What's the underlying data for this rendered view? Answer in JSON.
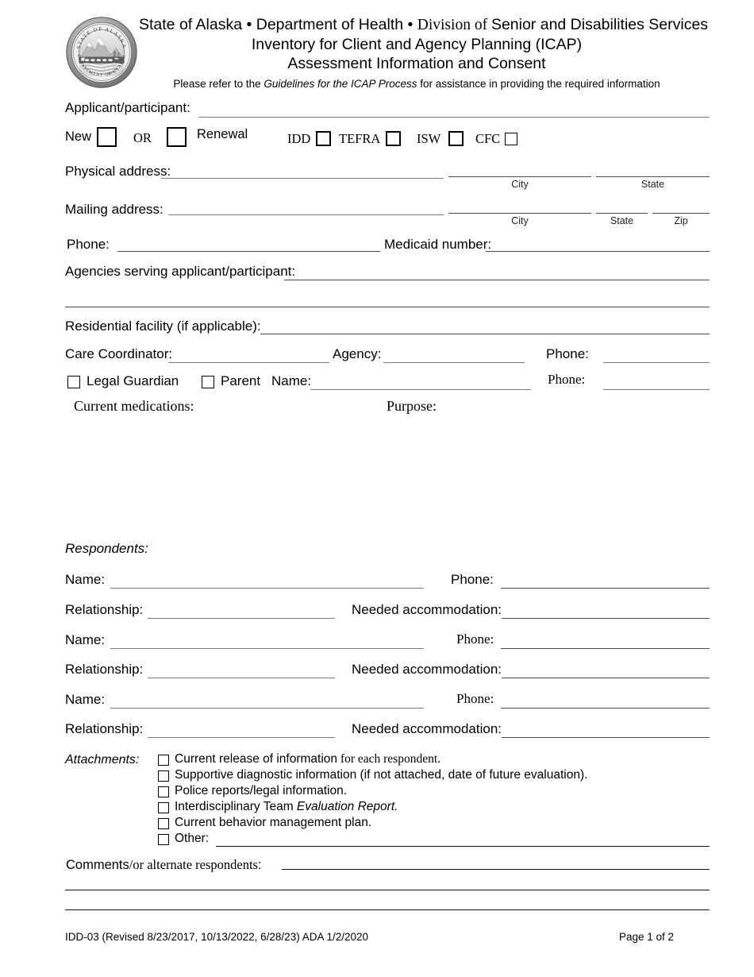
{
  "document": {
    "agency_line_a": "State of Alaska • Department of Health • ",
    "agency_line_b": "Division of ",
    "agency_line_c": "Senior and Disabilities Services",
    "title_line1": "Inventory for Client and Agency Planning (ICAP)",
    "title_line2": "Assessment Information and Consent",
    "instruction_a": "Please refer to the ",
    "instruction_b": "Guidelines for the ICAP Process",
    "instruction_c": " for assistance in providing the required information",
    "seal_outer_top": "STATE OF ALASKA",
    "seal_outer_bottom": "DEPARTMENT OF HEALTH"
  },
  "applicant": {
    "label": "Applicant/participant:",
    "value": "",
    "new_label": "New",
    "or_label": "OR",
    "renewal_label": "Renewal",
    "programs": [
      {
        "label": "IDD",
        "checked": false
      },
      {
        "label": "TEFRA",
        "checked": false
      },
      {
        "label": "ISW",
        "checked": false
      },
      {
        "label": "CFC",
        "checked": false
      }
    ],
    "new_checked": false,
    "renewal_checked": false
  },
  "address": {
    "physical_label": "Physical address:",
    "physical_street": "",
    "physical_city": "",
    "physical_state": "",
    "mailing_label": "Mailing address:",
    "mailing_street": "",
    "mailing_city": "",
    "mailing_state": "",
    "mailing_zip": "",
    "caption_city": "City",
    "caption_state": "State",
    "caption_zip": "Zip"
  },
  "contact": {
    "phone_label": "Phone:",
    "phone_value": "",
    "medicaid_label": "Medicaid number:",
    "medicaid_value": "",
    "agencies_label": "Agencies serving applicant/participant:",
    "agencies_value": "",
    "agencies_value_2": ""
  },
  "facility": {
    "residential_label": "Residential facility (if applicable):",
    "residential_value": "",
    "care_coordinator_label": "Care Coordinator:",
    "care_coordinator_value": "",
    "agency_label": "Agency:",
    "agency_value": "",
    "phone_label": "Phone:",
    "phone_value": ""
  },
  "guardian": {
    "legal_guardian_label": "Legal Guardian",
    "legal_guardian_checked": false,
    "parent_label": "Parent",
    "parent_checked": false,
    "name_label": "Name:",
    "name_value": "",
    "phone_label": "Phone:",
    "phone_value": ""
  },
  "medications": {
    "medications_label": "Current medications:",
    "purpose_label": "Purpose:",
    "medications_value": "",
    "purpose_value": ""
  },
  "respondents": {
    "heading": "Respondents:",
    "rows": [
      {
        "name_label": "Name:",
        "name_value": "",
        "phone_label": "Phone:",
        "phone_value": "",
        "relationship_label": "Relationship:",
        "relationship_value": "",
        "accommodation_label": "Needed accommodation:",
        "accommodation_value": ""
      },
      {
        "name_label": "Name:",
        "name_value": "",
        "phone_label": "Phone:",
        "phone_value": "",
        "relationship_label": "Relationship:",
        "relationship_value": "",
        "accommodation_label": "Needed accommodation:",
        "accommodation_value": ""
      },
      {
        "name_label": "Name:",
        "name_value": "",
        "phone_label": "Phone:",
        "phone_value": "",
        "relationship_label": "Relationship:",
        "relationship_value": "",
        "accommodation_label": "Needed accommodation:",
        "accommodation_value": ""
      }
    ]
  },
  "attachments": {
    "heading": "Attachments:",
    "items": [
      {
        "text_a": "Current release of information",
        "text_b": " for each respondent.",
        "italic_b": false,
        "serif_b": true,
        "checked": false
      },
      {
        "text_a": "Supportive diagnostic information (if not attached, date of future evaluation).",
        "text_b": "",
        "italic_b": false,
        "serif_b": false,
        "checked": false
      },
      {
        "text_a": "Police reports/legal information.",
        "text_b": "",
        "italic_b": false,
        "serif_b": false,
        "checked": false
      },
      {
        "text_a": "Interdisciplinary Team ",
        "text_b": "Evaluation Report.",
        "italic_b": true,
        "serif_b": false,
        "checked": false
      },
      {
        "text_a": "Current behavior management plan.",
        "text_b": "",
        "italic_b": false,
        "serif_b": false,
        "checked": false
      },
      {
        "text_a": "Other:",
        "text_b": "",
        "italic_b": false,
        "serif_b": false,
        "checked": false
      }
    ],
    "other_value": ""
  },
  "comments": {
    "label_a": "Comments",
    "label_b": "/or alternate respondents",
    "label_c": ":",
    "line1": "",
    "line2": "",
    "line3": ""
  },
  "footer": {
    "form_id": "IDD-03 (Revised 8/23/2017, 10/13/2022, 6/28/23) ADA 1/2/2020",
    "page": "Page 1 of 2"
  },
  "colors": {
    "rule_gray": "#7b7b7b",
    "rule_dark": "#4a4a4a",
    "ink": "#000000",
    "seal_gray": "#8c8c8c"
  }
}
